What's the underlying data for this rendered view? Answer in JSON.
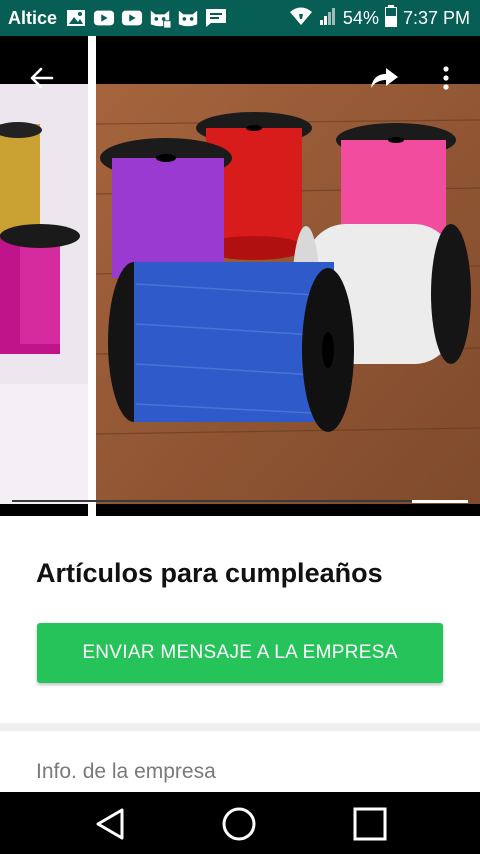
{
  "status_bar": {
    "carrier": "Altice",
    "battery": "54%",
    "time": "7:37 PM",
    "background": "#075e54",
    "icons": [
      "image-icon",
      "youtube-icon",
      "youtube-icon",
      "cat-face-icon",
      "cat-face-icon",
      "message-icon",
      "wifi-icon",
      "signal-icon",
      "battery-icon"
    ]
  },
  "gallery": {
    "active_index_fraction": 0.88,
    "icons": [
      "back-arrow-icon",
      "share-icon",
      "more-vert-icon"
    ]
  },
  "business": {
    "title": "Artículos para cumpleaños",
    "cta_label": "ENVIAR MENSAJE A LA EMPRESA",
    "cta_color": "#25c35a",
    "info_label": "Info. de la empresa"
  },
  "navbar": {
    "icons": [
      "back-triangle-icon",
      "home-circle-icon",
      "recents-square-icon"
    ]
  }
}
